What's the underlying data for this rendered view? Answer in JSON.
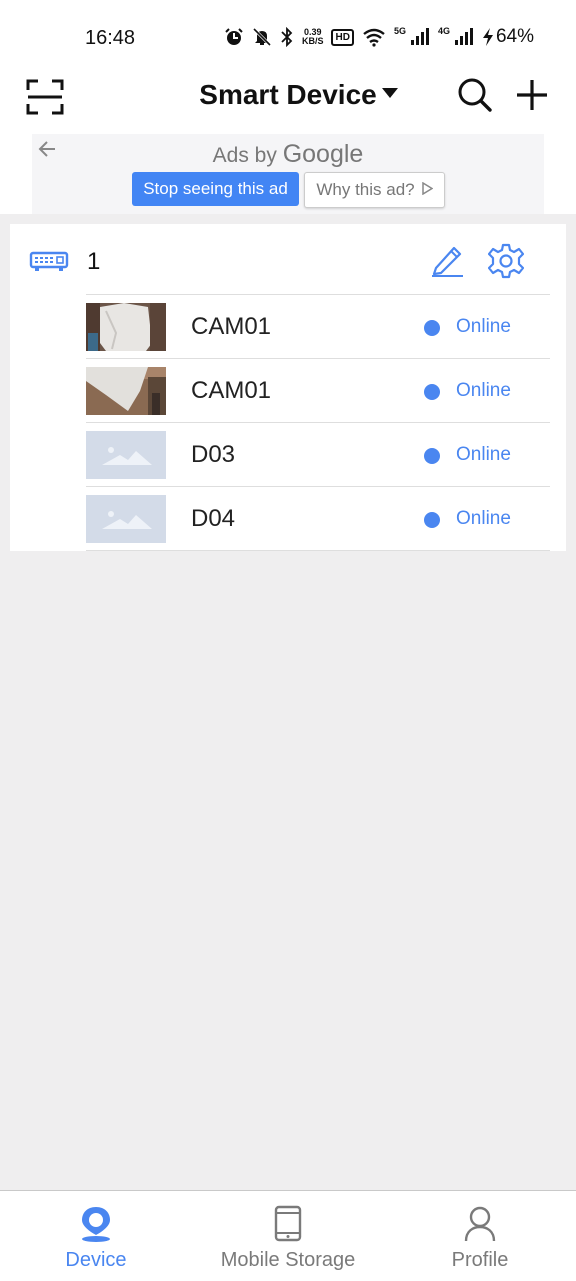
{
  "status_bar": {
    "time": "16:48",
    "speed_value": "0.39",
    "speed_unit": "KB/S",
    "hd_label": "HD",
    "net_5g": "5G",
    "net_4g": "4G",
    "battery": "64%"
  },
  "header": {
    "title": "Smart Device"
  },
  "ad": {
    "ads_by": "Ads by",
    "google": "Google",
    "stop_button": "Stop seeing this ad",
    "why_button": "Why this ad?"
  },
  "device_group": {
    "name": "1",
    "channels": [
      {
        "name": "CAM01",
        "status": "Online",
        "thumb": "photo"
      },
      {
        "name": "CAM01",
        "status": "Online",
        "thumb": "photo"
      },
      {
        "name": "D03",
        "status": "Online",
        "thumb": "placeholder"
      },
      {
        "name": "D04",
        "status": "Online",
        "thumb": "placeholder"
      }
    ]
  },
  "bottom_nav": {
    "items": [
      {
        "label": "Device",
        "icon": "location-pin-icon",
        "active": true
      },
      {
        "label": "Mobile Storage",
        "icon": "tablet-icon",
        "active": false
      },
      {
        "label": "Profile",
        "icon": "person-icon",
        "active": false
      }
    ]
  },
  "colors": {
    "accent": "#4a86f0",
    "ad_button": "#4285f4",
    "background": "#efeeef"
  }
}
